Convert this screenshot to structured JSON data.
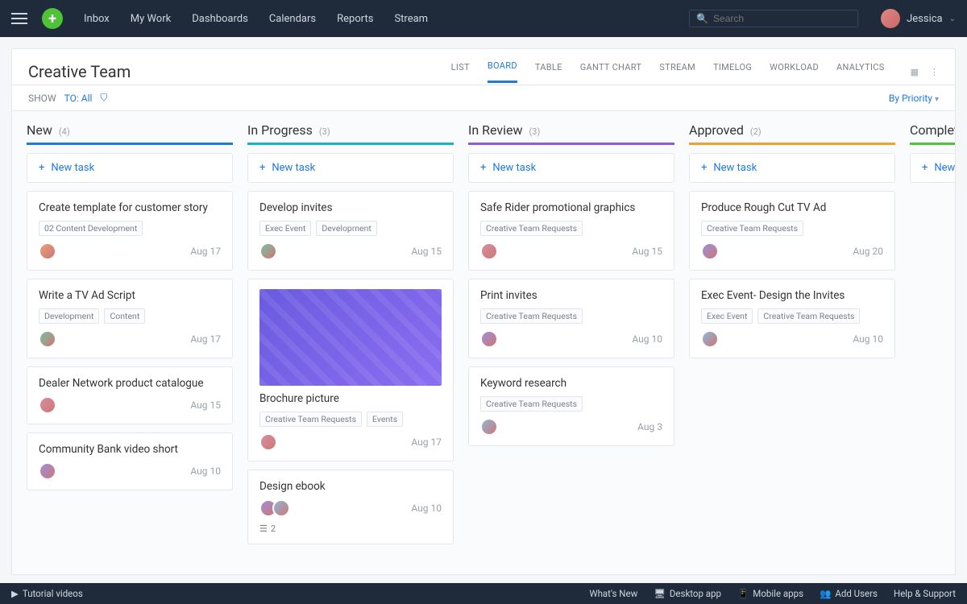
{
  "nav": {
    "links": [
      "Inbox",
      "My Work",
      "Dashboards",
      "Calendars",
      "Reports",
      "Stream"
    ],
    "search_placeholder": "Search",
    "user": "Jessica"
  },
  "panel": {
    "title": "Creative Team",
    "tabs": [
      "LIST",
      "BOARD",
      "TABLE",
      "GANTT CHART",
      "STREAM",
      "TIMELOG",
      "WORKLOAD",
      "ANALYTICS"
    ],
    "active_tab": "BOARD"
  },
  "filter": {
    "show_label": "SHOW",
    "to_label": "TO:",
    "to_value": "All",
    "sort": "By Priority"
  },
  "newtask_label": "New task",
  "columns": [
    {
      "name": "New",
      "count": "(4)",
      "color": "#1f7ae0",
      "cards": [
        {
          "title": "Create template for customer story",
          "tags": [
            "02 Content Development"
          ],
          "date": "Aug 17",
          "avatars": 1
        },
        {
          "title": "Write a TV Ad Script",
          "tags": [
            "Development",
            "Content"
          ],
          "date": "Aug 17",
          "avatars": 1
        },
        {
          "title": "Dealer Network product catalogue",
          "tags": [],
          "date": "Aug 15",
          "avatars": 1
        },
        {
          "title": "Community Bank video short",
          "tags": [],
          "date": "Aug 10",
          "avatars": 1
        }
      ]
    },
    {
      "name": "In Progress",
      "count": "(3)",
      "color": "#17b1c9",
      "cards": [
        {
          "title": "Develop invites",
          "tags": [
            "Exec Event",
            "Development"
          ],
          "date": "Aug 15",
          "avatars": 1
        },
        {
          "title": "Brochure picture",
          "tags": [
            "Creative Team Requests",
            "Events"
          ],
          "date": "Aug 17",
          "avatars": 1,
          "thumb": true
        },
        {
          "title": "Design ebook",
          "tags": [],
          "date": "Aug 10",
          "avatars": 2,
          "subtasks": 2
        }
      ]
    },
    {
      "name": "In Review",
      "count": "(3)",
      "color": "#8b5be0",
      "cards": [
        {
          "title": "Safe Rider promotional graphics",
          "tags": [
            "Creative Team Requests"
          ],
          "date": "Aug 15",
          "avatars": 1
        },
        {
          "title": "Print invites",
          "tags": [
            "Creative Team Requests"
          ],
          "date": "Aug 10",
          "avatars": 1
        },
        {
          "title": "Keyword research",
          "tags": [
            "Creative Team Requests"
          ],
          "date": "Aug 3",
          "avatars": 1
        }
      ]
    },
    {
      "name": "Approved",
      "count": "(2)",
      "color": "#f0a030",
      "cards": [
        {
          "title": "Produce Rough Cut TV Ad",
          "tags": [
            "Creative Team Requests"
          ],
          "date": "Aug 20",
          "avatars": 1
        },
        {
          "title": "Exec Event- Design the Invites",
          "tags": [
            "Exec Event",
            "Creative Team Requests"
          ],
          "date": "Aug 10",
          "avatars": 1
        }
      ]
    },
    {
      "name": "Completed",
      "count": "",
      "color": "#4fc23a",
      "cards": []
    }
  ],
  "footer": {
    "tutorial": "Tutorial videos",
    "links": [
      "What's New",
      "Desktop app",
      "Mobile apps",
      "Add Users",
      "Help & Support"
    ]
  }
}
